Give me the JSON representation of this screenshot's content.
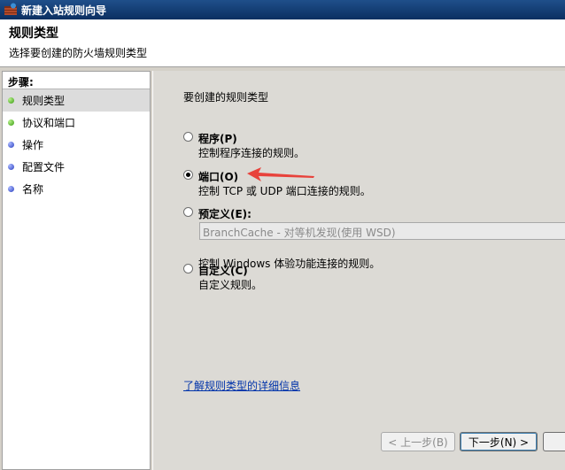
{
  "window": {
    "title": "新建入站规则向导"
  },
  "header": {
    "title": "规则类型",
    "subtitle": "选择要创建的防火墙规则类型"
  },
  "sidebar": {
    "label": "步骤:",
    "steps": [
      {
        "label": "规则类型",
        "status": "done",
        "active": true
      },
      {
        "label": "协议和端口",
        "status": "done",
        "active": false
      },
      {
        "label": "操作",
        "status": "pending",
        "active": false
      },
      {
        "label": "配置文件",
        "status": "pending",
        "active": false
      },
      {
        "label": "名称",
        "status": "pending",
        "active": false
      }
    ]
  },
  "main": {
    "question": "要创建的规则类型",
    "options": [
      {
        "label": "程序(P)",
        "desc": "控制程序连接的规则。",
        "selected": false
      },
      {
        "label": "端口(O)",
        "desc": "控制 TCP 或 UDP 端口连接的规则。",
        "selected": true
      },
      {
        "label": "预定义(E):",
        "desc": "控制 Windows 体验功能连接的规则。",
        "selected": false
      },
      {
        "label": "自定义(C)",
        "desc": "自定义规则。",
        "selected": false
      }
    ],
    "predefined_select_value": "BranchCache - 对等机发现(使用 WSD)",
    "help_link": "了解规则类型的详细信息"
  },
  "buttons": {
    "back": "< 上一步(B)",
    "next": "下一步(N) >"
  },
  "colors": {
    "titlebar": "#0b2f61",
    "link": "#0033aa",
    "annotation_arrow": "#e8423b",
    "bullet_done": "#3a9b12",
    "bullet_pending": "#2a3fbf"
  }
}
